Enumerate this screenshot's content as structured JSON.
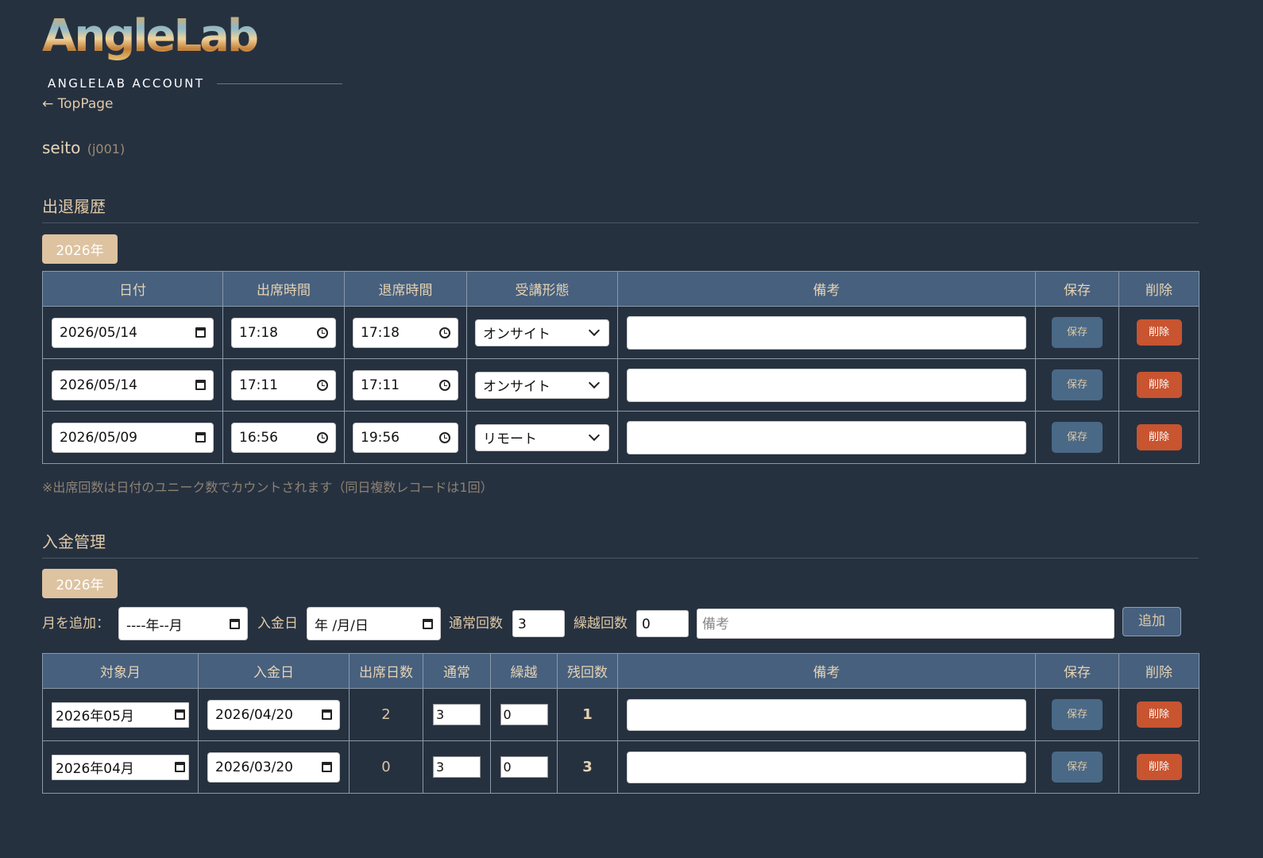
{
  "brand": {
    "logo_text": "AngleLab",
    "account_label": "ANGLELAB ACCOUNT",
    "back_link": "← TopPage"
  },
  "user": {
    "name": "seito",
    "id": "(j001)"
  },
  "attendance": {
    "title": "出退履歴",
    "year_button": "2026年",
    "headers": [
      "日付",
      "出席時間",
      "退席時間",
      "受講形態",
      "備考",
      "保存",
      "削除"
    ],
    "rows": [
      {
        "date": "2026/05/14",
        "in": "17:18",
        "out": "17:18",
        "mode": "オンサイト",
        "memo": "",
        "save": "保存",
        "delete": "削除"
      },
      {
        "date": "2026/05/14",
        "in": "17:11",
        "out": "17:11",
        "mode": "オンサイト",
        "memo": "",
        "save": "保存",
        "delete": "削除"
      },
      {
        "date": "2026/05/09",
        "in": "16:56",
        "out": "19:56",
        "mode": "リモート",
        "memo": "",
        "save": "保存",
        "delete": "削除"
      }
    ],
    "note": "※出席回数は日付のユニーク数でカウントされます（同日複数レコードは1回）"
  },
  "payment": {
    "title": "入金管理",
    "year_button": "2026年",
    "add_form": {
      "month_label": "月を追加：",
      "month_value": "----年--月",
      "date_label": "入金日",
      "date_value": "年 /月/日",
      "normal_label": "通常回数",
      "normal_value": "3",
      "carry_label": "繰越回数",
      "carry_value": "0",
      "memo_placeholder": "備考",
      "add_button": "追加"
    },
    "headers": [
      "対象月",
      "入金日",
      "出席日数",
      "通常",
      "繰越",
      "残回数",
      "備考",
      "保存",
      "削除"
    ],
    "rows": [
      {
        "month": "2026年05月",
        "date": "2026/04/20",
        "attend": "2",
        "normal": "3",
        "carry": "0",
        "remain": "1",
        "memo": "",
        "save": "保存",
        "delete": "削除"
      },
      {
        "month": "2026年04月",
        "date": "2026/03/20",
        "attend": "0",
        "normal": "3",
        "carry": "0",
        "remain": "3",
        "memo": "",
        "save": "保存",
        "delete": "削除"
      }
    ]
  }
}
